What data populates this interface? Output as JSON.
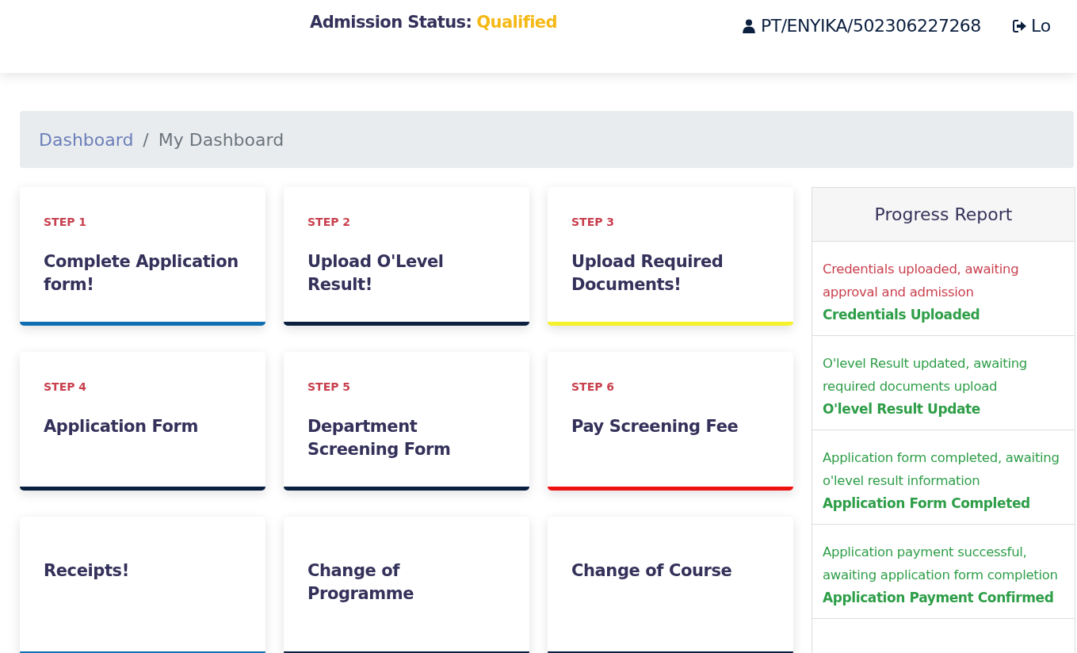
{
  "header": {
    "status_label": "Admission Status:",
    "status_value": "Qualified",
    "user_id": "PT/ENYIKA/502306227268",
    "logout": "Lo"
  },
  "breadcrumb_separator": "/",
  "breadcrumb": [
    {
      "label": "Dashboard",
      "selected": false
    },
    {
      "label": "My Dashboard",
      "selected": true
    }
  ],
  "cards": [
    {
      "step": "STEP 1",
      "title": "Complete Application form!",
      "color": "#0f6fb0"
    },
    {
      "step": "STEP 2",
      "title": "Upload O'Level Result!",
      "color": "#0b1f3f"
    },
    {
      "step": "STEP 3",
      "title": "Upload Required Documents!",
      "color": "#f5f12a"
    },
    {
      "step": "STEP 4",
      "title": "Application Form",
      "color": "#0b1f3f"
    },
    {
      "step": "STEP 5",
      "title": "Department Screening Form",
      "color": "#0b1f3f"
    },
    {
      "step": "STEP 6",
      "title": "Pay Screening Fee",
      "color": "#ee1111"
    },
    {
      "title": "Receipts!",
      "color": "#0f6fb0"
    },
    {
      "title": "Change of Programme",
      "color": "#0b1f3f"
    },
    {
      "title": "Change of Course",
      "color": "#0b1f3f"
    }
  ],
  "progress_report": {
    "title": "Progress Report",
    "entries": [
      {
        "message": "Credentials uploaded, awaiting approval and admission",
        "status": "Credentials Uploaded",
        "color": "#c9404e"
      },
      {
        "message": "O'level Result updated, awaiting required documents upload",
        "status": "O'level Result Update",
        "color": "#2e9e48"
      },
      {
        "message": "Application form completed, awaiting o'level result information",
        "status": "Application Form Completed",
        "color": "#2e9e48"
      },
      {
        "message": "Application payment successful, awaiting application form completion",
        "status": "Application Payment Confirmed",
        "color": "#2e9e48"
      }
    ]
  }
}
